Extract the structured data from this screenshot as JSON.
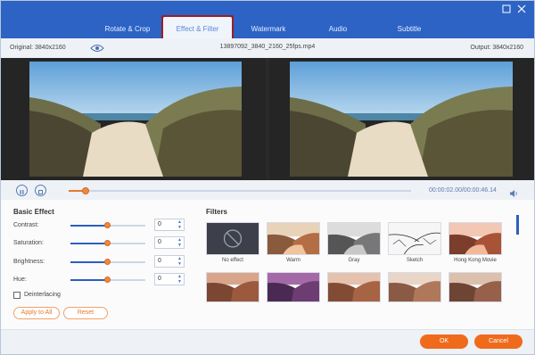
{
  "tabs": [
    {
      "label": "Rotate & Crop"
    },
    {
      "label": "Effect & Filter"
    },
    {
      "label": "Watermark"
    },
    {
      "label": "Audio"
    },
    {
      "label": "Subtitle"
    }
  ],
  "info": {
    "original": "Original: 3840x2160",
    "filename": "13897092_3840_2160_25fps.mp4",
    "output": "Output: 3840x2160"
  },
  "playback": {
    "timecode": "00:00:02.00/00:00:46.14",
    "progress_fraction": 0.05
  },
  "basic_effect": {
    "title": "Basic Effect",
    "items": [
      {
        "label": "Contrast:",
        "value": "0",
        "level": 0.5
      },
      {
        "label": "Saturation:",
        "value": "0",
        "level": 0.5
      },
      {
        "label": "Brightness:",
        "value": "0",
        "level": 0.5
      },
      {
        "label": "Hue:",
        "value": "0",
        "level": 0.5
      }
    ],
    "deinterlacing": "Deinterlacing",
    "apply_all": "Apply to All",
    "reset": "Reset"
  },
  "filters": {
    "title": "Filters",
    "items": [
      {
        "label": "No effect"
      },
      {
        "label": "Warm"
      },
      {
        "label": "Gray"
      },
      {
        "label": "Sketch"
      },
      {
        "label": "Hong Kong Movie"
      }
    ]
  },
  "footer": {
    "ok": "OK",
    "cancel": "Cancel"
  },
  "colors": {
    "accent": "#2c63c4",
    "orange": "#f06a1c",
    "highlight": "#9d1e25"
  },
  "icons": [
    "restore-icon",
    "close-icon",
    "eye-icon",
    "pause-icon",
    "stop-icon",
    "volume-icon",
    "no-effect-icon"
  ]
}
